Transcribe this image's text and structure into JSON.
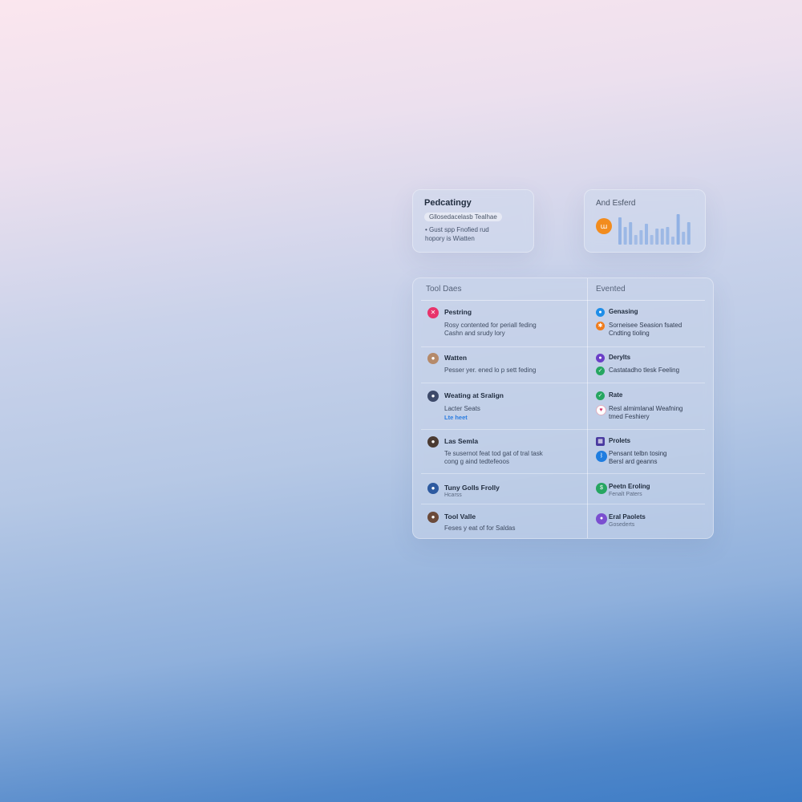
{
  "card_a": {
    "title": "Pedcatingy",
    "pill": "Gllosedacelasb Tealhae",
    "line1": "• Gust spp Fnofied rud",
    "line2": "hopory is Wiatten"
  },
  "card_b": {
    "title": "And Esferd",
    "badge_icon": "chart-icon",
    "badge_glyph": "ա",
    "badge_color": "#f28c1e",
    "bar_color": "#8fb0e3",
    "bars": [
      0.85,
      0.55,
      0.7,
      0.3,
      0.45,
      0.65,
      0.3,
      0.5,
      0.5,
      0.55,
      0.25,
      0.95,
      0.4,
      0.7
    ]
  },
  "main": {
    "left_header": "Tool Daes",
    "right_header": "Evented",
    "left_items": [
      {
        "icon": "avatar-pink",
        "color": "#e8336b",
        "name": "Pestring",
        "desc1": "Rosy contented for periall feding",
        "desc2": "Cashn and srudy lory"
      },
      {
        "icon": "avatar-photo",
        "color": "#b58a6a",
        "name": "Watten",
        "desc1": "Pesser yer. ened lo p sett feding"
      },
      {
        "icon": "avatar-photo",
        "color": "#3d4a6a",
        "name": "Weating at Sralign",
        "desc1": "Lacter Seats",
        "link": "Lte heet"
      },
      {
        "icon": "avatar-photo",
        "color": "#4a3a32",
        "name": "Las Semla",
        "desc1": "Te susernot feat tod gat of tral task",
        "desc2": "cong g aind tedtefeoos"
      },
      {
        "icon": "avatar-photo",
        "color": "#2d5aa0",
        "name": "Tuny Golls Frolly",
        "sub": "Hcarss"
      },
      {
        "icon": "avatar-photo",
        "color": "#6b4a3a",
        "name": "Tool Valle",
        "desc1": "Feses y eat of for Saldas"
      }
    ],
    "right_items": [
      {
        "lines": [
          {
            "icon": "drop-icon",
            "color": "#1f8ee8",
            "text": "Genasing",
            "bold": true
          },
          {
            "icon": "gear-icon",
            "color": "#f07d1e",
            "text": "Sorneisee Seasion fsated",
            "text2": "Cndting tioling"
          }
        ]
      },
      {
        "lines": [
          {
            "icon": "user-icon",
            "color": "#6b3fc7",
            "text": "Derylts",
            "bold": true
          },
          {
            "icon": "leaf-icon",
            "color": "#26a661",
            "text": "Castatadho tlesk Feeling"
          }
        ]
      },
      {
        "lines": [
          {
            "icon": "leaf-icon",
            "color": "#26a661",
            "text": "Rate",
            "bold": true
          },
          {
            "icon": "heart-icon",
            "color": "#ffffff",
            "text": "Resl almimlanal Weafning",
            "text2": "tmed Feshiery"
          }
        ]
      },
      {
        "lines": [
          {
            "icon": "grid-icon",
            "color": "#4a3aa0",
            "square": true,
            "text": "Prolets",
            "bold": true
          },
          {
            "icon": "bluetooth-icon",
            "color": "#1f7de0",
            "text": "Pensant telbn tosing",
            "text2": "Bersl ard geanns"
          }
        ]
      },
      {
        "lines": [
          {
            "icon": "dollar-icon",
            "color": "#26a661",
            "text": "Peetn Eroling",
            "bold": true,
            "sub": "Fenalt Paters"
          }
        ]
      },
      {
        "lines": [
          {
            "icon": "user-icon",
            "color": "#7b4fd0",
            "text": "Eral Paolets",
            "bold": true,
            "sub": "Gosederts"
          }
        ]
      }
    ]
  }
}
